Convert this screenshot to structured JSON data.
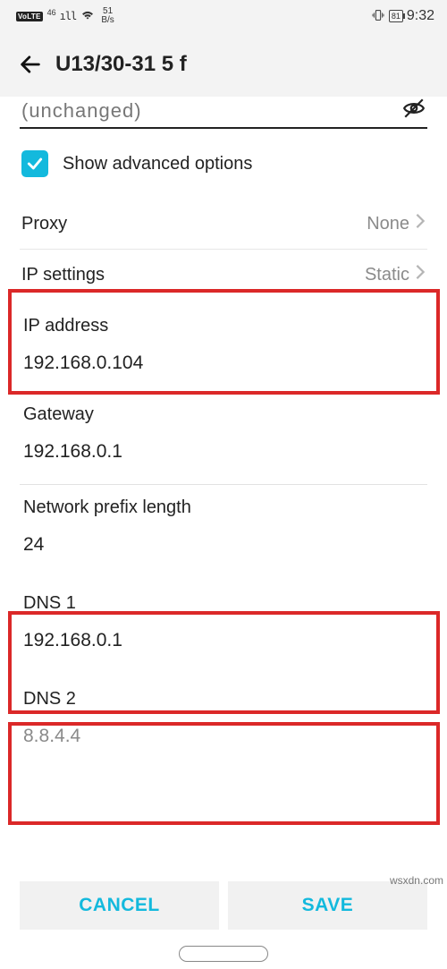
{
  "status": {
    "volte": "VoLTE",
    "net_gen": "46",
    "speed_top": "51",
    "speed_unit": "B/s",
    "battery": "81",
    "time": "9:32"
  },
  "header": {
    "title": "U13/30-31 5 f"
  },
  "unchanged": "(unchanged)",
  "advanced_label": "Show advanced options",
  "proxy": {
    "label": "Proxy",
    "value": "None"
  },
  "ip_settings": {
    "label": "IP settings",
    "value": "Static"
  },
  "ip_address": {
    "label": "IP address",
    "value": "192.168.0.104"
  },
  "gateway": {
    "label": "Gateway",
    "value": "192.168.0.1"
  },
  "prefix": {
    "label": "Network prefix length",
    "value": "24"
  },
  "dns1": {
    "label": "DNS 1",
    "value": "192.168.0.1"
  },
  "dns2": {
    "label": "DNS 2",
    "value": "8.8.4.4"
  },
  "buttons": {
    "cancel": "CANCEL",
    "save": "SAVE"
  },
  "watermark": "wsxdn.com"
}
